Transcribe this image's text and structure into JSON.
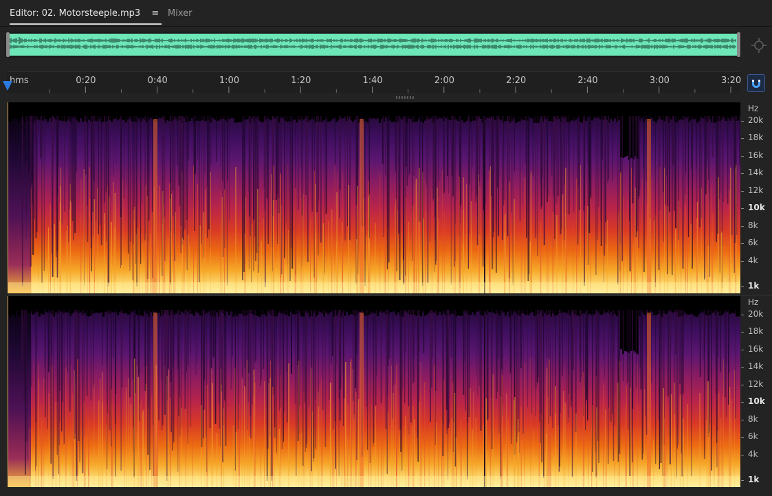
{
  "tabs": {
    "editor_label": "Editor: 02. Motorsteeple.mp3",
    "menu_glyph": "≡",
    "mixer_label": "Mixer"
  },
  "ruler": {
    "unit": "hms",
    "labels": [
      "0:20",
      "0:40",
      "1:00",
      "1:20",
      "1:40",
      "2:00",
      "2:20",
      "2:40",
      "3:00",
      "3:20"
    ]
  },
  "spectrogram": {
    "unit": "Hz",
    "freq_labels": [
      "20k",
      "18k",
      "16k",
      "14k",
      "12k",
      "10k",
      "8k",
      "6k",
      "4k",
      "1k"
    ],
    "bold_labels": [
      "10k",
      "1k"
    ]
  },
  "colors": {
    "waveform": "#6de6b8",
    "playhead": "#2d7be0",
    "background": "#232323"
  },
  "icons": {
    "zoom_navigator": "crosshair-zoom-icon",
    "snap": "magnet-icon"
  }
}
